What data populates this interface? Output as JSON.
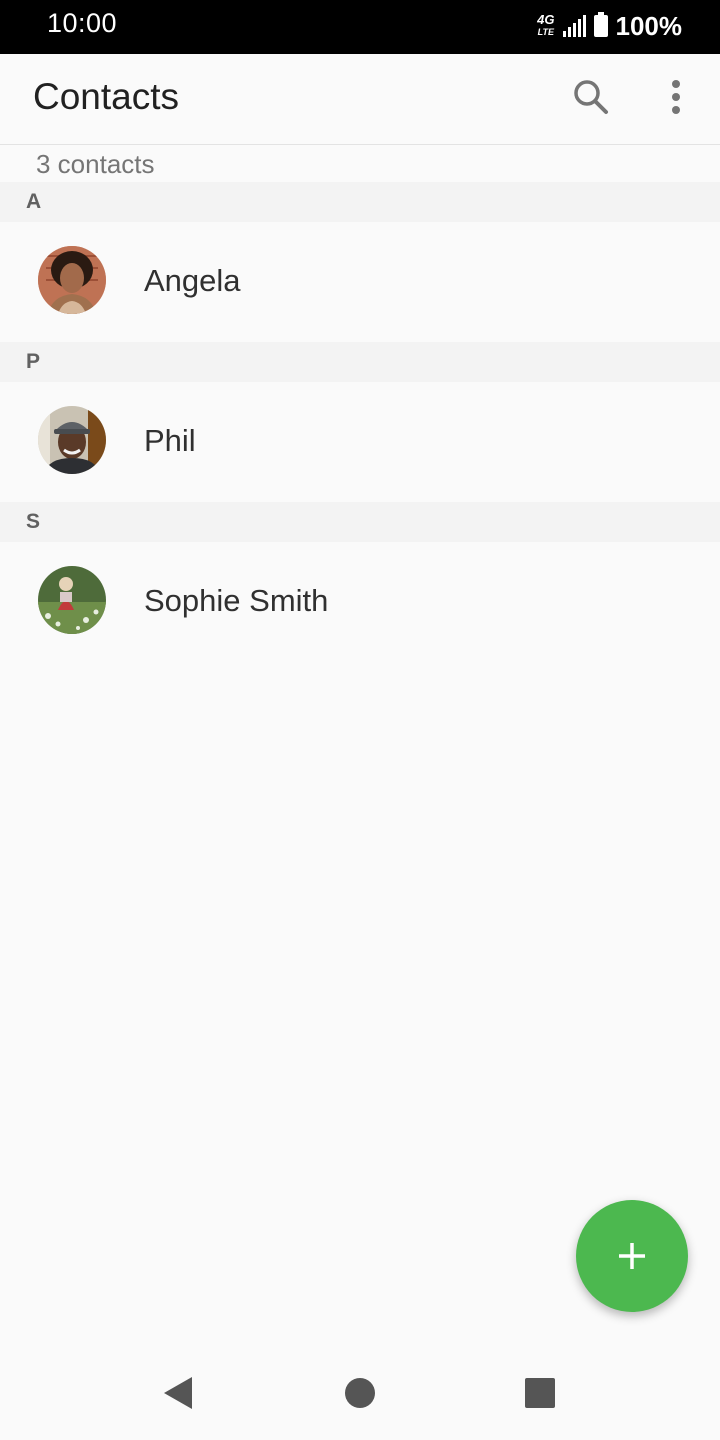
{
  "status_bar": {
    "time": "10:00",
    "network": "4G",
    "network_sub": "LTE",
    "battery": "100%",
    "icons": [
      "signal-icon",
      "battery-icon"
    ]
  },
  "app_bar": {
    "title": "Contacts",
    "icons": [
      "search-icon",
      "more-vert-icon"
    ]
  },
  "contact_count": "3 contacts",
  "sections": [
    {
      "letter": "A",
      "contacts": [
        {
          "name": "Angela"
        }
      ]
    },
    {
      "letter": "P",
      "contacts": [
        {
          "name": "Phil"
        }
      ]
    },
    {
      "letter": "S",
      "contacts": [
        {
          "name": "Sophie Smith"
        }
      ]
    }
  ],
  "fab": {
    "icon": "add-icon",
    "color": "#4cb84f"
  },
  "nav_bar": {
    "icons": [
      "back-icon",
      "home-icon",
      "recents-icon"
    ]
  },
  "colors": {
    "accent": "#4cb84f",
    "status_bar": "#000000",
    "background": "#fafafa",
    "section_header": "#f3f3f3"
  }
}
